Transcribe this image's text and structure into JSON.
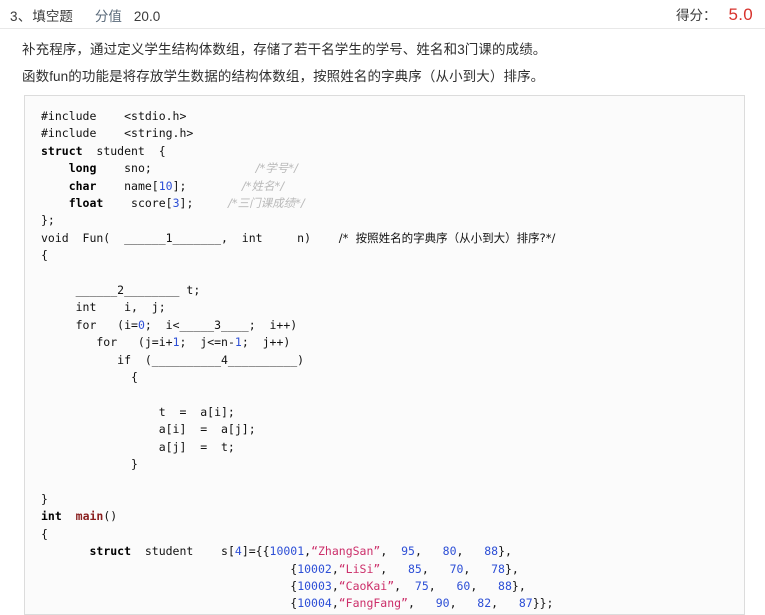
{
  "header": {
    "index": "3、",
    "type": "填空题",
    "points_label": "分值",
    "points_value": "20.0",
    "score_label": "得分：",
    "score_value": "5.0",
    "score_color": "#d7322c"
  },
  "description": {
    "line1": "补充程序，通过定义学生结构体数组，存储了若干名学生的学号、姓名和3门课的成绩。",
    "line2": "函数fun的功能是将存放学生数据的结构体数组，按照姓名的字典序（从小到大）排序。"
  },
  "code": {
    "language": "c",
    "lines": [
      {
        "indent": 0,
        "tokens": [
          {
            "t": "#include    ",
            "c": "plain"
          },
          {
            "t": "<stdio.h>",
            "c": "plain"
          }
        ]
      },
      {
        "indent": 0,
        "tokens": [
          {
            "t": "#include    ",
            "c": "plain"
          },
          {
            "t": "<string.h>",
            "c": "plain"
          }
        ]
      },
      {
        "indent": 0,
        "tokens": [
          {
            "t": "struct",
            "c": "kw"
          },
          {
            "t": "  student  {",
            "c": "plain"
          }
        ]
      },
      {
        "indent": 0,
        "tokens": [
          {
            "t": "    ",
            "c": "plain"
          },
          {
            "t": "long",
            "c": "kw"
          },
          {
            "t": "    sno;               ",
            "c": "plain"
          },
          {
            "t": "/*学号*/",
            "c": "cmt-gray"
          }
        ]
      },
      {
        "indent": 0,
        "tokens": [
          {
            "t": "    ",
            "c": "plain"
          },
          {
            "t": "char",
            "c": "kw"
          },
          {
            "t": "    name[",
            "c": "plain"
          },
          {
            "t": "10",
            "c": "num"
          },
          {
            "t": "];        ",
            "c": "plain"
          },
          {
            "t": "/*姓名*/",
            "c": "cmt-gray"
          }
        ]
      },
      {
        "indent": 0,
        "tokens": [
          {
            "t": "    ",
            "c": "plain"
          },
          {
            "t": "float",
            "c": "kw"
          },
          {
            "t": "    score[",
            "c": "plain"
          },
          {
            "t": "3",
            "c": "num"
          },
          {
            "t": "];     ",
            "c": "plain"
          },
          {
            "t": "/*三门课成绩*/",
            "c": "cmt-gray"
          }
        ]
      },
      {
        "indent": 0,
        "tokens": [
          {
            "t": "};",
            "c": "plain"
          }
        ]
      },
      {
        "indent": 0,
        "tokens": [
          {
            "t": "void  Fun(  ______1_______,  int     n)    ",
            "c": "plain"
          },
          {
            "t": "/*  按照姓名的字典序（从小到大）排序?*/",
            "c": "cmt-blk"
          }
        ]
      },
      {
        "indent": 0,
        "tokens": [
          {
            "t": "{",
            "c": "plain"
          }
        ]
      },
      {
        "indent": 0,
        "tokens": [
          {
            "t": "",
            "c": "plain"
          }
        ]
      },
      {
        "indent": 0,
        "tokens": [
          {
            "t": "     ______2________ t;",
            "c": "plain"
          }
        ]
      },
      {
        "indent": 0,
        "tokens": [
          {
            "t": "     int    i,  j;",
            "c": "plain"
          }
        ]
      },
      {
        "indent": 0,
        "tokens": [
          {
            "t": "     for   (i=",
            "c": "plain"
          },
          {
            "t": "0",
            "c": "num"
          },
          {
            "t": ";  i<_____3____;  i++)",
            "c": "plain"
          }
        ]
      },
      {
        "indent": 0,
        "tokens": [
          {
            "t": "        for   (j=i+",
            "c": "plain"
          },
          {
            "t": "1",
            "c": "num"
          },
          {
            "t": ";  j<=n-",
            "c": "plain"
          },
          {
            "t": "1",
            "c": "num"
          },
          {
            "t": ";  j++)",
            "c": "plain"
          }
        ]
      },
      {
        "indent": 0,
        "tokens": [
          {
            "t": "           if  (__________4__________)",
            "c": "plain"
          }
        ]
      },
      {
        "indent": 0,
        "tokens": [
          {
            "t": "             {",
            "c": "plain"
          }
        ]
      },
      {
        "indent": 0,
        "tokens": [
          {
            "t": "",
            "c": "plain"
          }
        ]
      },
      {
        "indent": 0,
        "tokens": [
          {
            "t": "                 t  =  a[i];",
            "c": "plain"
          }
        ]
      },
      {
        "indent": 0,
        "tokens": [
          {
            "t": "                 a[i]  =  a[j];",
            "c": "plain"
          }
        ]
      },
      {
        "indent": 0,
        "tokens": [
          {
            "t": "                 a[j]  =  t;",
            "c": "plain"
          }
        ]
      },
      {
        "indent": 0,
        "tokens": [
          {
            "t": "             }",
            "c": "plain"
          }
        ]
      },
      {
        "indent": 0,
        "tokens": [
          {
            "t": "",
            "c": "plain"
          }
        ]
      },
      {
        "indent": 0,
        "tokens": [
          {
            "t": "}",
            "c": "plain"
          }
        ]
      },
      {
        "indent": 0,
        "tokens": [
          {
            "t": "int",
            "c": "kw"
          },
          {
            "t": "  ",
            "c": "plain"
          },
          {
            "t": "main",
            "c": "fn"
          },
          {
            "t": "()",
            "c": "plain"
          }
        ]
      },
      {
        "indent": 0,
        "tokens": [
          {
            "t": "{",
            "c": "plain"
          }
        ]
      },
      {
        "indent": 0,
        "tokens": [
          {
            "t": "       ",
            "c": "plain"
          },
          {
            "t": "struct",
            "c": "kw"
          },
          {
            "t": "  student    s[",
            "c": "plain"
          },
          {
            "t": "4",
            "c": "num"
          },
          {
            "t": "]={{",
            "c": "plain"
          },
          {
            "t": "10001",
            "c": "num"
          },
          {
            "t": ",",
            "c": "plain"
          },
          {
            "t": "“ZhangSan”",
            "c": "str"
          },
          {
            "t": ",  ",
            "c": "plain"
          },
          {
            "t": "95",
            "c": "num"
          },
          {
            "t": ",   ",
            "c": "plain"
          },
          {
            "t": "80",
            "c": "num"
          },
          {
            "t": ",   ",
            "c": "plain"
          },
          {
            "t": "88",
            "c": "num"
          },
          {
            "t": "},",
            "c": "plain"
          }
        ]
      },
      {
        "indent": 0,
        "tokens": [
          {
            "t": "                                    {",
            "c": "plain"
          },
          {
            "t": "10002",
            "c": "num"
          },
          {
            "t": ",",
            "c": "plain"
          },
          {
            "t": "“LiSi”",
            "c": "str"
          },
          {
            "t": ",   ",
            "c": "plain"
          },
          {
            "t": "85",
            "c": "num"
          },
          {
            "t": ",   ",
            "c": "plain"
          },
          {
            "t": "70",
            "c": "num"
          },
          {
            "t": ",   ",
            "c": "plain"
          },
          {
            "t": "78",
            "c": "num"
          },
          {
            "t": "},",
            "c": "plain"
          }
        ]
      },
      {
        "indent": 0,
        "tokens": [
          {
            "t": "                                    {",
            "c": "plain"
          },
          {
            "t": "10003",
            "c": "num"
          },
          {
            "t": ",",
            "c": "plain"
          },
          {
            "t": "“CaoKai”",
            "c": "str"
          },
          {
            "t": ",  ",
            "c": "plain"
          },
          {
            "t": "75",
            "c": "num"
          },
          {
            "t": ",   ",
            "c": "plain"
          },
          {
            "t": "60",
            "c": "num"
          },
          {
            "t": ",   ",
            "c": "plain"
          },
          {
            "t": "88",
            "c": "num"
          },
          {
            "t": "},",
            "c": "plain"
          }
        ]
      },
      {
        "indent": 0,
        "tokens": [
          {
            "t": "                                    {",
            "c": "plain"
          },
          {
            "t": "10004",
            "c": "num"
          },
          {
            "t": ",",
            "c": "plain"
          },
          {
            "t": "“FangFang”",
            "c": "str"
          },
          {
            "t": ",   ",
            "c": "plain"
          },
          {
            "t": "90",
            "c": "num"
          },
          {
            "t": ",   ",
            "c": "plain"
          },
          {
            "t": "82",
            "c": "num"
          },
          {
            "t": ",   ",
            "c": "plain"
          },
          {
            "t": "87",
            "c": "num"
          },
          {
            "t": "}};",
            "c": "plain"
          }
        ]
      }
    ]
  }
}
